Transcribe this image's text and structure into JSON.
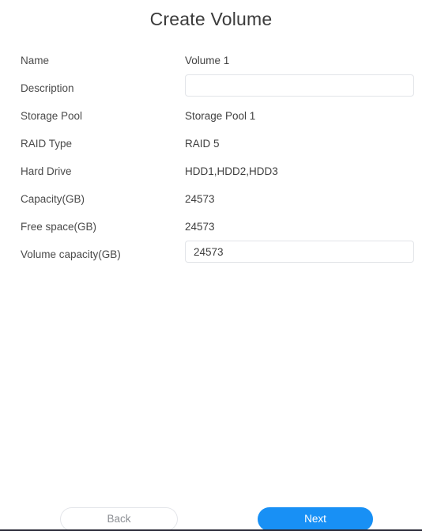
{
  "page": {
    "title": "Create Volume"
  },
  "form": {
    "rows": [
      {
        "label": "Name",
        "value": "Volume 1",
        "type": "text"
      },
      {
        "label": "Description",
        "value": "",
        "type": "input",
        "placeholder": ""
      },
      {
        "label": "Storage Pool",
        "value": "Storage Pool 1",
        "type": "text"
      },
      {
        "label": "RAID Type",
        "value": "RAID 5",
        "type": "text"
      },
      {
        "label": "Hard Drive",
        "value": "HDD1,HDD2,HDD3",
        "type": "text"
      },
      {
        "label": "Capacity(GB)",
        "value": "24573",
        "type": "text"
      },
      {
        "label": "Free space(GB)",
        "value": "24573",
        "type": "text"
      },
      {
        "label": "Volume capacity(GB)",
        "value": "24573",
        "type": "input",
        "placeholder": ""
      }
    ]
  },
  "footer": {
    "back_label": "Back",
    "next_label": "Next"
  },
  "colors": {
    "accent": "#1890f5",
    "label_text": "#4a4a4a",
    "value_text": "#3f3f3f",
    "title_text": "#3b3b3b",
    "input_border": "#e2e4e8",
    "back_text": "#8c8f94"
  }
}
